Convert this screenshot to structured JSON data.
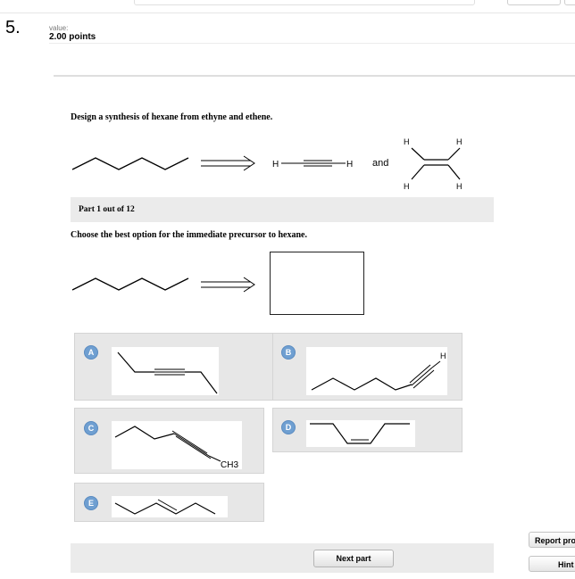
{
  "question": {
    "number": "5.",
    "value_label": "value:",
    "points": "2.00 points",
    "text": "Design a synthesis of hexane from ethyne and ethene."
  },
  "scheme": {
    "ethyne_h_left": "H",
    "ethyne_h_right": "H",
    "and_label": "and",
    "ethene_h": [
      "H",
      "H",
      "H",
      "H"
    ]
  },
  "part": {
    "label": "Part 1 out of 12",
    "prompt": "Choose the best option for the immediate precursor to hexane."
  },
  "options": [
    {
      "letter": "A"
    },
    {
      "letter": "B",
      "atom_label": "H"
    },
    {
      "letter": "C",
      "atom_label": "CH3"
    },
    {
      "letter": "D"
    },
    {
      "letter": "E"
    }
  ],
  "buttons": {
    "next_part": "Next part",
    "report": "Report problem",
    "hint": "Hint"
  }
}
